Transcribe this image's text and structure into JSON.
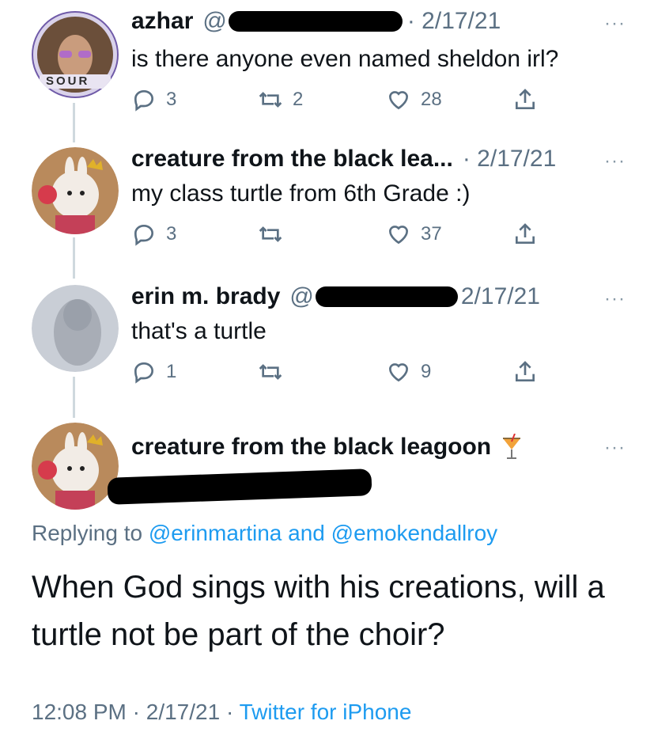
{
  "tweets": [
    {
      "name": "azhar",
      "handle": "@",
      "date": "· 2/17/21",
      "text": "is there anyone even named sheldon irl?",
      "reply_count": "3",
      "retweet_count": "2",
      "like_count": "28",
      "avatar_badge": "SOUR"
    },
    {
      "name": "creature from the black lea...",
      "date": "· 2/17/21",
      "text": "my class turtle from 6th Grade :)",
      "reply_count": "3",
      "retweet_count": "",
      "like_count": "37"
    },
    {
      "name": "erin m. brady",
      "handle": "@",
      "date": "2/17/21",
      "text": "that's a turtle",
      "reply_count": "1",
      "retweet_count": "",
      "like_count": "9"
    }
  ],
  "main_tweet": {
    "name": "creature from the black leagoon",
    "replying_prefix": "Replying to",
    "mention1": "@erinmartina",
    "and_word": "and",
    "mention2": "@emokendallroy",
    "text": "When God sings with his creations, will a turtle not be part of the choir?",
    "time": "12:08 PM",
    "date": "2/17/21",
    "separator": "·",
    "source": "Twitter for iPhone"
  },
  "more_label": "···",
  "colors": {
    "link": "#1d9bf0",
    "secondary": "#5b7083",
    "thread_line": "#cfd9de"
  }
}
